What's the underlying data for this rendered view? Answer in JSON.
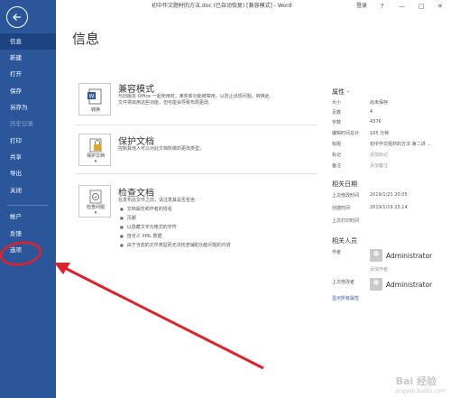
{
  "titlebar": {
    "doc_title": "初中作文题材的方法.doc (已自动恢复) [兼容模式] - Word",
    "login": "登录",
    "help": "?",
    "minimize": "—",
    "restore": "□",
    "close": "✕"
  },
  "nav": {
    "items": [
      {
        "label": "信息"
      },
      {
        "label": "新建"
      },
      {
        "label": "打开"
      },
      {
        "label": "保存"
      },
      {
        "label": "另存为"
      },
      {
        "label": "历史记录"
      },
      {
        "label": "打印"
      },
      {
        "label": "共享"
      },
      {
        "label": "导出"
      },
      {
        "label": "关闭"
      },
      {
        "label": "帐户"
      },
      {
        "label": "反馈"
      },
      {
        "label": "选项"
      }
    ]
  },
  "main": {
    "title": "信息",
    "compat": {
      "tile_label": "转换",
      "title": "兼容模式",
      "desc1": "与旧版本 Office 一起使用时，某些新功能被禁用，以防止出现问题。转换此",
      "desc2": "文件将启用这些功能，但可能会导致布局更改。"
    },
    "protect": {
      "tile_label": "保护文档",
      "title": "保护文档",
      "desc": "控制其他人可以对此文档所做的更改类型。"
    },
    "inspect": {
      "tile_label": "检查问题",
      "title": "检查文档",
      "desc": "在发布此文件之前，请注意其是否包含:",
      "bullets": [
        "文档属性和作者的姓名",
        "页脚",
        "以隐藏文字为格式的字符",
        "自定义 XML 数据",
        "由于当前的文件类型而无法检查辅助功能问题的内容"
      ]
    }
  },
  "props": {
    "title": "属性 -",
    "rows": [
      {
        "label": "大小",
        "value": "尚未保存"
      },
      {
        "label": "页数",
        "value": "4"
      },
      {
        "label": "字数",
        "value": "4376"
      },
      {
        "label": "编辑时间总计",
        "value": "105 分钟"
      },
      {
        "label": "标题",
        "value": "初中作文题材的方法 第二讲 ..."
      },
      {
        "label": "标记",
        "value": "添加标记"
      },
      {
        "label": "备注",
        "value": "添加备注"
      }
    ],
    "dates_title": "相关日期",
    "dates": [
      {
        "label": "上次修改时间",
        "value": "2019/1/21 20:05"
      },
      {
        "label": "创建时间",
        "value": "2019/1/19 23:14"
      },
      {
        "label": "上次打印时间",
        "value": ""
      }
    ],
    "people_title": "相关人员",
    "author_label": "作者",
    "author_name": "Administrator",
    "add_author": "添加作者",
    "last_modified_label": "上次修改者",
    "last_modified_name": "Administrator",
    "show_all": "显示所有属性"
  },
  "watermark": {
    "text": "Bai 经验",
    "sub": "jingyan.baidu.com"
  }
}
